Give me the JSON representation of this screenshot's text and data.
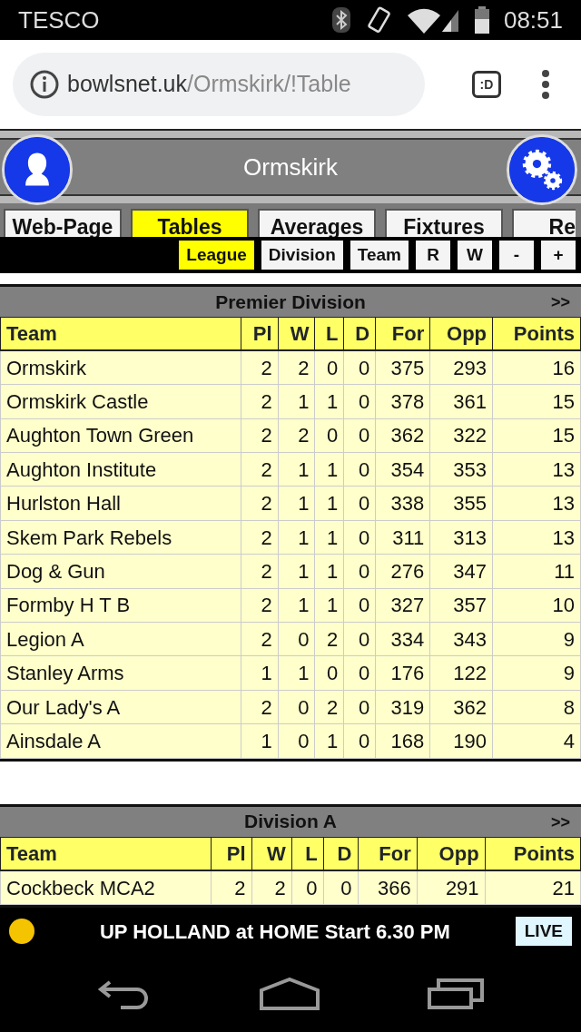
{
  "status_bar": {
    "carrier": "TESCO",
    "time": "08:51"
  },
  "browser": {
    "url_host": "bowlsnet.uk",
    "url_path": "/Ormskirk/!Table",
    "tab_count": ":D"
  },
  "header": {
    "title": "Ormskirk"
  },
  "tabs": [
    {
      "label": "Web-Page",
      "selected": false
    },
    {
      "label": "Tables",
      "selected": true
    },
    {
      "label": "Averages",
      "selected": false
    },
    {
      "label": "Fixtures",
      "selected": false
    },
    {
      "label": "Re",
      "selected": false
    }
  ],
  "sub_tabs": [
    {
      "label": "League",
      "selected": true
    },
    {
      "label": "Division",
      "selected": false
    },
    {
      "label": "Team",
      "selected": false
    },
    {
      "label": "R",
      "selected": false
    },
    {
      "label": "W",
      "selected": false
    },
    {
      "label": "-",
      "selected": false
    },
    {
      "label": "+",
      "selected": false
    }
  ],
  "tables": [
    {
      "title": "Premier Division",
      "more": ">>",
      "columns": [
        "Team",
        "Pl",
        "W",
        "L",
        "D",
        "For",
        "Opp",
        "Points"
      ],
      "rows": [
        [
          "Ormskirk",
          "2",
          "2",
          "0",
          "0",
          "375",
          "293",
          "16"
        ],
        [
          "Ormskirk Castle",
          "2",
          "1",
          "1",
          "0",
          "378",
          "361",
          "15"
        ],
        [
          "Aughton Town Green",
          "2",
          "2",
          "0",
          "0",
          "362",
          "322",
          "15"
        ],
        [
          "Aughton Institute",
          "2",
          "1",
          "1",
          "0",
          "354",
          "353",
          "13"
        ],
        [
          "Hurlston Hall",
          "2",
          "1",
          "1",
          "0",
          "338",
          "355",
          "13"
        ],
        [
          "Skem Park Rebels",
          "2",
          "1",
          "1",
          "0",
          "311",
          "313",
          "13"
        ],
        [
          "Dog & Gun",
          "2",
          "1",
          "1",
          "0",
          "276",
          "347",
          "11"
        ],
        [
          "Formby H T B",
          "2",
          "1",
          "1",
          "0",
          "327",
          "357",
          "10"
        ],
        [
          "Legion A",
          "2",
          "0",
          "2",
          "0",
          "334",
          "343",
          "9"
        ],
        [
          "Stanley Arms",
          "1",
          "1",
          "0",
          "0",
          "176",
          "122",
          "9"
        ],
        [
          "Our Lady's A",
          "2",
          "0",
          "2",
          "0",
          "319",
          "362",
          "8"
        ],
        [
          "Ainsdale A",
          "1",
          "0",
          "1",
          "0",
          "168",
          "190",
          "4"
        ]
      ]
    },
    {
      "title": "Division A",
      "more": ">>",
      "columns": [
        "Team",
        "Pl",
        "W",
        "L",
        "D",
        "For",
        "Opp",
        "Points"
      ],
      "rows": [
        [
          "Cockbeck MCA2",
          "2",
          "2",
          "0",
          "0",
          "366",
          "291",
          "21"
        ]
      ]
    }
  ],
  "live_bar": {
    "message": "UP HOLLAND at HOME Start 6.30 PM",
    "button": "LIVE"
  }
}
